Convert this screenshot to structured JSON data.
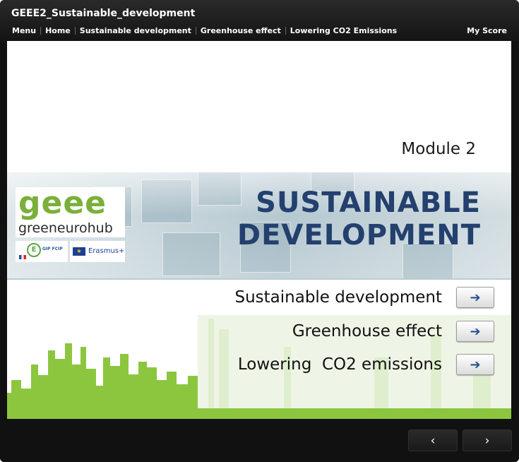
{
  "app": {
    "title": "GEEE2_Sustainable_development"
  },
  "breadcrumb": {
    "items": [
      "Menu",
      "Home",
      "Sustainable development",
      "Greenhouse effect",
      "Lowering CO2 Emissions"
    ],
    "my_score": "My Score"
  },
  "slide": {
    "module_label": "Module 2",
    "banner_title_line1": "SUSTAINABLE",
    "banner_title_line2": "DEVELOPMENT",
    "logo": {
      "brand": "geee",
      "sub": "greeneurohub"
    },
    "partners": {
      "gip_label": "GIP FCIP",
      "erasmus_label": "Erasmus+"
    },
    "links": [
      {
        "label": "Sustainable development"
      },
      {
        "label": "Greenhouse effect"
      },
      {
        "label": "Lowering  CO2 emissions"
      }
    ]
  },
  "colors": {
    "accent_green": "#8cc63f",
    "banner_blue": "#23406e",
    "arrow_blue": "#2a4f8c"
  },
  "icons": {
    "link_arrow": "arrow-right-icon",
    "prev": "chevron-left-icon",
    "next": "chevron-right-icon"
  }
}
